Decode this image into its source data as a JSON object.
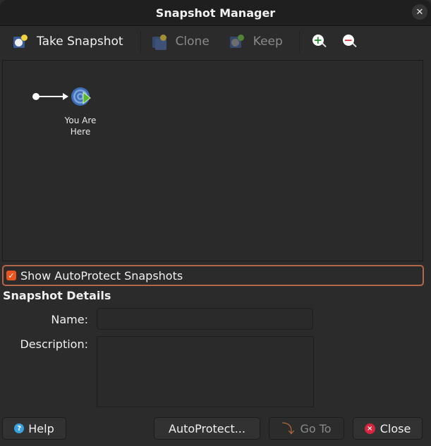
{
  "window": {
    "title": "Snapshot Manager",
    "close_icon": "close-icon"
  },
  "toolbar": {
    "take_snapshot": {
      "label": "Take Snapshot",
      "icon": "take-snapshot-icon",
      "enabled": true
    },
    "clone": {
      "label": "Clone",
      "icon": "clone-icon",
      "enabled": false
    },
    "keep": {
      "label": "Keep",
      "icon": "keep-icon",
      "enabled": false
    },
    "zoom_in": {
      "icon": "zoom-in-icon",
      "glyph": "+"
    },
    "zoom_out": {
      "icon": "zoom-out-icon",
      "glyph": "−"
    }
  },
  "tree": {
    "current_node": {
      "label_line1": "You Are",
      "label_line2": "Here",
      "icon": "you-are-here-icon"
    }
  },
  "autoprotect": {
    "label": "Show AutoProtect Snapshots",
    "checked": true,
    "check_glyph": "✓"
  },
  "details": {
    "title": "Snapshot Details",
    "name_label": "Name:",
    "name_value": "",
    "description_label": "Description:",
    "description_value": ""
  },
  "buttons": {
    "help": {
      "label": "Help",
      "icon_glyph": "?"
    },
    "autoprotect": {
      "label": "AutoProtect..."
    },
    "goto": {
      "label": "Go To",
      "enabled": false,
      "icon_glyph": "⤵"
    },
    "close": {
      "label": "Close",
      "icon_glyph": "×"
    }
  },
  "colors": {
    "accent": "#e95420",
    "focus_border": "#b3664a",
    "background": "#2b2b2b"
  }
}
